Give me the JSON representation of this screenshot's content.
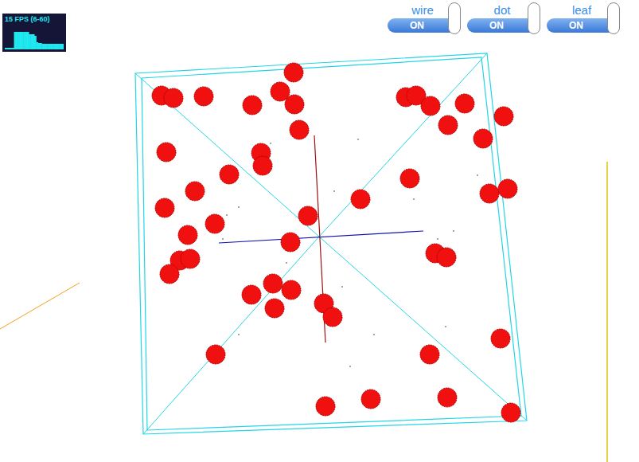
{
  "fps_meter": {
    "label": "15 FPS (6-60)",
    "max": 60,
    "values": [
      0,
      0,
      0,
      0,
      0,
      40,
      40,
      40,
      40,
      40,
      40,
      40,
      40,
      34,
      34,
      34,
      30,
      14,
      12,
      12,
      10,
      10,
      10,
      10,
      10,
      10,
      10,
      10,
      10,
      10,
      10,
      10
    ]
  },
  "toggles": [
    {
      "label": "wire",
      "state": "ON",
      "on": true
    },
    {
      "label": "dot",
      "state": "ON",
      "on": true
    },
    {
      "label": "leaf",
      "state": "ON",
      "on": true
    }
  ]
}
